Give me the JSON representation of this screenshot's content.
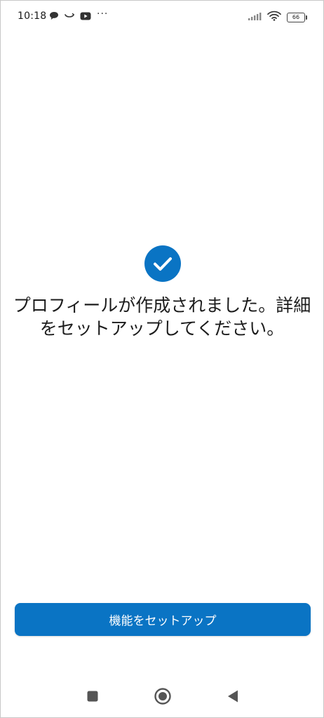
{
  "status_bar": {
    "time": "10:18",
    "battery_level": "66",
    "notification_icons": [
      "chat-bubble-icon",
      "smile-arc-icon",
      "youtube-icon"
    ],
    "overflow": "···",
    "system_icons": [
      "signal-icon",
      "wifi-icon",
      "battery-icon"
    ]
  },
  "main": {
    "success_icon": "check-circle-icon",
    "message": "プロフィールが作成されました。詳細をセットアップしてください。",
    "accent_color": "#0a74c4"
  },
  "actions": {
    "setup_label": "機能をセットアップ"
  },
  "nav_bar": {
    "buttons": [
      "recents-square-icon",
      "home-circle-icon",
      "back-triangle-icon"
    ]
  }
}
